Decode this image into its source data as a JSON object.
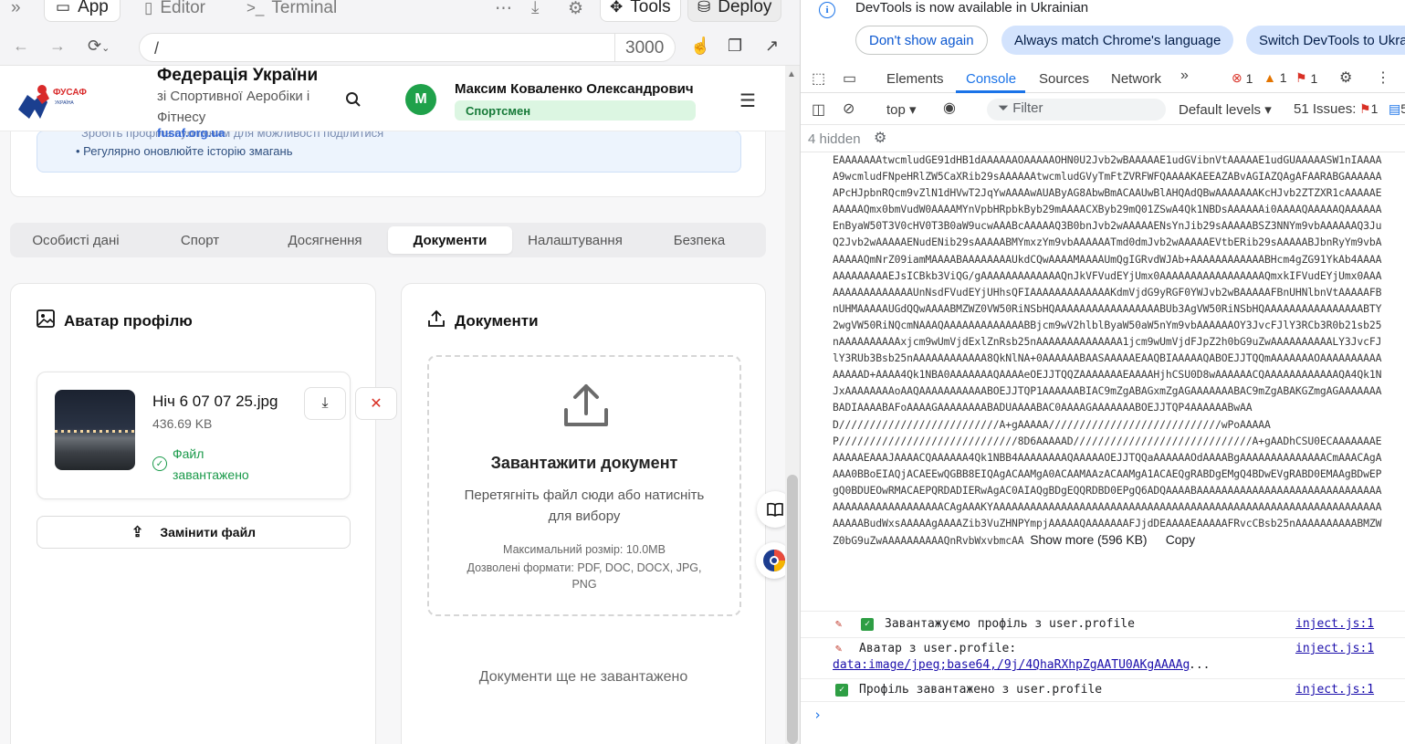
{
  "workspace": {
    "topbar": {
      "expand_icon": "double-chevron-icon",
      "app_tab": "App",
      "editor_tab": "Editor",
      "terminal_tab": "Terminal",
      "tools_label": "Tools",
      "deploy_label": "Deploy"
    },
    "urlbar": {
      "path": "/",
      "port": "3000"
    }
  },
  "site": {
    "header": {
      "org_title": "Федерація України",
      "org_subtitle": "зі Спортивної Аеробіки і Фітнесу",
      "org_link": "fusaf.org.ua",
      "logo_text": "ФУСАФ",
      "logo_sub": "УКРАЇНА",
      "user_initial": "M",
      "user_name": "Максим Коваленко Олександрович",
      "user_role": "Спортсмен"
    },
    "info": {
      "line1": "Зробіть профіль публічним для можливості поділитися",
      "line2": "• Регулярно оновлюйте історію змагань"
    },
    "tabs": [
      "Особисті дані",
      "Спорт",
      "Досягнення",
      "Документи",
      "Налаштування",
      "Безпека"
    ],
    "active_tab": "Документи",
    "avatar_card": {
      "title": "Аватар профілю",
      "file_name": "Ніч 6 07 07 25.jpg",
      "file_size": "436.69 KB",
      "status_line1": "Файл",
      "status_line2": "завантажено",
      "replace_label": "Замінити файл"
    },
    "docs_card": {
      "title": "Документи",
      "upload_title": "Завантажити документ",
      "upload_hint": "Перетягніть файл сюди або натисніть для вибору",
      "max_size": "Максимальний розмір: 10.0MB",
      "formats": "Дозволені формати: PDF, DOC, DOCX, JPG, PNG",
      "empty": "Документи ще не завантажено"
    }
  },
  "devtools": {
    "banner": {
      "message": "DevTools is now available in Ukrainian",
      "btn_dismiss": "Don't show again",
      "btn_match": "Always match Chrome's language",
      "btn_switch": "Switch DevTools to Ukrainian"
    },
    "tabs": [
      "Elements",
      "Console",
      "Sources",
      "Network"
    ],
    "active_tab": "Console",
    "counts": {
      "errors": "1",
      "warnings": "1",
      "issues_badge": "1"
    },
    "toolbar": {
      "context": "top",
      "filter_placeholder": "Filter",
      "levels": "Default levels",
      "issues_label": "51 Issues:",
      "issues_errors": "1",
      "issues_info": "5"
    },
    "hidden": "4 hidden",
    "base64_text": "EAAAAAAAtwcmludGE91dHB1dAAAAAAOAAAAAOHN0U2Jvb2wBAAAAAE1udGVibnVtAAAAAE1udGUAAAAASW1nIAAAAA9wcmludFNpeHRlZW5CaXRib29sAAAAAAtwcmludGVyTmFtZVRFWFQAAAAKAEEAZABvAGIAZQAgAFAARABGAAAAAAAPcHJpbnRQcm9vZlN1dHVwT2JqYwAAAAwAUAByAG8AbwBmACAAUwBlAHQAdQBwAAAAAAAKcHJvb2ZTZXR1cAAAAAEAAAAAQmx0bmVudW0AAAAMYnVpbHRpbkByb29mAAAACXByb29mQ01ZSwA4Qk1NBDsAAAAAAi0AAAAQAAAAAQAAAAAAEnByaW50T3V0cHV0T3B0aW9ucwAAABcAAAAAQ3B0bnJvb2wAAAAAENsYnJib29sAAAAABSZ3NNYm9vbAAAAAAQ3JuQ2Jvb2wAAAAAENudENib29sAAAAABMYmxzYm9vbAAAAAATmd0dmJvb2wAAAAAEVtbERib29sAAAAABJbnRyYm9vbAAAAAAQmNrZ09iamMAAAABAAAAAAAAUkdCQwAAAAMAAAAUmQgIGRvdWJAb+AAAAAAAAAAAABHcm4gZG91YkAb4AAAAAAAAAAAAAEJsICBkb3ViQG/gAAAAAAAAAAAAAQnJkVFVudEYjUmx0AAAAAAAAAAAAAAAAAQmxkIFVudEYjUmx0AAAAAAAAAAAAAAAAUnNsdFVudEYjUHhsQFIAAAAAAAAAAAAAKdmVjdG9yRGF0YWJvb2wBAAAAAFBnUHNlbnVtAAAAAFBnUHMAAAAAUGdQQwAAAABMZWZ0VW50RiNSbHQAAAAAAAAAAAAAAAAABUb3AgVW50RiNSbHQAAAAAAAAAAAAAAAABTY2wgVW50RiNQcmNAAAQAAAAAAAAAAAAABBjcm9wV2hlblByaW50aW5nYm9vbAAAAAAOY3JvcFJlY3RCb3R0b21sb25nAAAAAAAAAAxjcm9wUmVjdExlZnRsb25nAAAAAAAAAAAAAA1jcm9wUmVjdFJpZ2h0bG9uZwAAAAAAAAAALY3JvcFJlY3RUb3Bsb25nAAAAAAAAAAAA8QkNlNA+0AAAAAABAASAAAAAEAAQBIAAAAAQABOEJJTQQmAAAAAAAOAAAAAAAAAAAAAAAD+AAAA4Qk1NBA0AAAAAAAQAAAAeOEJJTQQZAAAAAAAEAAAAHjhCSU0D8wAAAAAACQAAAAAAAAAAAAQA4Qk1NJxAAAAAAAAoAAQAAAAAAAAAAABOEJJTQP1AAAAAABIAC9mZgABAGxmZgAGAAAAAAABAC9mZgABAKGZmgAGAAAAAAABADIAAAABAFoAAAAGAAAAAAAABADUAAAABAC0AAAAGAAAAAAABOEJJTQP4AAAAAABwAAD//////////////////////////A+gAAAAA////////////////////////////wPoAAAAAP/////////////////////////////8D6AAAAAD/////////////////////////////A+gAADhCSU0ECAAAAAAAEAAAAAEAAAJAAAACQAAAAAA4Qk1NBB4AAAAAAAAQAAAAAOEJJTQQaAAAAAAOdAAAABgAAAAAAAAAAAAAACmAAACAgAAAA0BBoEIAQjACAEEwQGBB8EIQAgACAAMgA0ACAAMAAzACAAMgA1ACAEQgRABDgEMgQ4BDwEVgRABD0EMAAgBDwEPgQ0BDUEOwRMACAEPQRDADIERwAgAC0AIAQgBDgEQQRDBD0EPgQ6ADQAAAABAAAAAAAAAAAAAAAAAAAAAAAAAAAAAAAAAAAAAAAAAAAAAAAACAgAAAKYAAAAAAAAAAAAAAAAAAAAAAAAAAAAAAAAAAAAAAAAAAAAAAAAAAAAAAAAAAAAAAAAAAAABudWxsAAAAAgAAAAZib3VuZHNPYmpjAAAAAQAAAAAAAFJjdDEAAAAEAAAAAFRvcCBsb25nAAAAAAAAAABMZWZ0bG9uZwAAAAAAAAAAQnRvbWxvbmcAA",
    "show_more": "Show more (596 KB)",
    "copy": "Copy",
    "logs": [
      {
        "text": "Завантажуємо профіль з user.profile",
        "source": "inject.js:1"
      },
      {
        "text": "Аватар з user.profile:",
        "link": "data:image/jpeg;base64,/9j/4QhaRXhpZgAATU0AKgAAAAg",
        "ellipsis": "...",
        "source": "inject.js:1"
      },
      {
        "text": "Профіль завантажено з user.profile",
        "source": "inject.js:1"
      }
    ],
    "prompt": "›"
  }
}
